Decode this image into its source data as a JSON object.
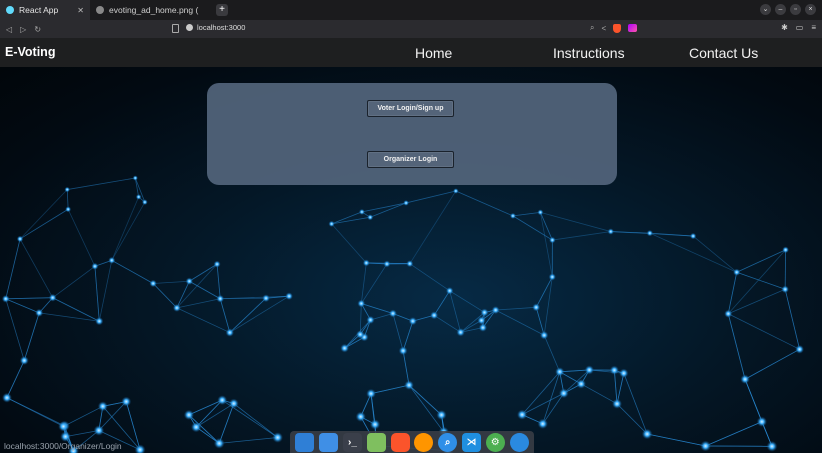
{
  "browser": {
    "tabs": [
      {
        "label": "React App",
        "active": true,
        "favicon_color": "#61dafb"
      },
      {
        "label": "evoting_ad_home.png (",
        "active": false,
        "favicon_color": "#888888"
      }
    ],
    "new_tab_label": "+",
    "url": "localhost:3000",
    "status_url": "localhost:3000/Organizer/Login"
  },
  "navbar": {
    "brand": "E-Voting",
    "links": [
      "Home",
      "Instructions",
      "Contact Us"
    ]
  },
  "panel": {
    "voter_button": "Voter Login/Sign up",
    "organizer_button": "Organizer Login"
  },
  "dock": {
    "apps": [
      {
        "name": "desktop",
        "color": "#2f7fd6"
      },
      {
        "name": "files",
        "color": "#3f8fe6"
      },
      {
        "name": "terminal",
        "color": "#3a3f4a"
      },
      {
        "name": "text-editor",
        "color": "#7fbf5f"
      },
      {
        "name": "brave",
        "color": "#fb542b"
      },
      {
        "name": "firefox",
        "color": "#ff9500"
      },
      {
        "name": "search",
        "color": "#2f8fe8"
      },
      {
        "name": "vscode",
        "color": "#1f8fe0"
      },
      {
        "name": "settings",
        "color": "#4caf50"
      },
      {
        "name": "docker",
        "color": "#2a8ae0"
      }
    ]
  },
  "colors": {
    "navbar_bg": "#1e1f20",
    "panel_bg": "#53657c",
    "hero_bg": "#041726"
  }
}
